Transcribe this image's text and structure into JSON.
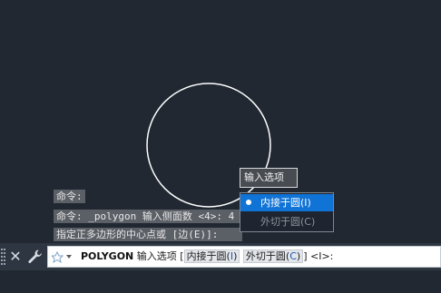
{
  "history": {
    "line1": "命令:",
    "line2": "命令: _polygon 输入侧面数 <4>: 4",
    "line3": "指定正多边形的中心点或 [边(E)]:"
  },
  "dynamic_input": {
    "title": "输入选项",
    "options": [
      {
        "label": "内接于圆(I)",
        "selected": true
      },
      {
        "label": "外切于圆(C)",
        "selected": false
      }
    ]
  },
  "command_line": {
    "command": "POLYGON",
    "prompt_text": "输入选项",
    "open_bracket": "[",
    "option1_prefix": "内接于圆(",
    "option1_key": "I",
    "option1_suffix": ")",
    "option2_prefix": "外切于圆(",
    "option2_key": "C",
    "option2_suffix": ")",
    "close_bracket": "]",
    "default_value": "<I>:"
  },
  "icons": {
    "close": "close-icon",
    "customize": "wrench-icon",
    "prompt": "command-prompt-icon",
    "grip": "grip-icon"
  },
  "colors": {
    "canvas_bg": "#212832",
    "selected_option": "#1073d6"
  }
}
